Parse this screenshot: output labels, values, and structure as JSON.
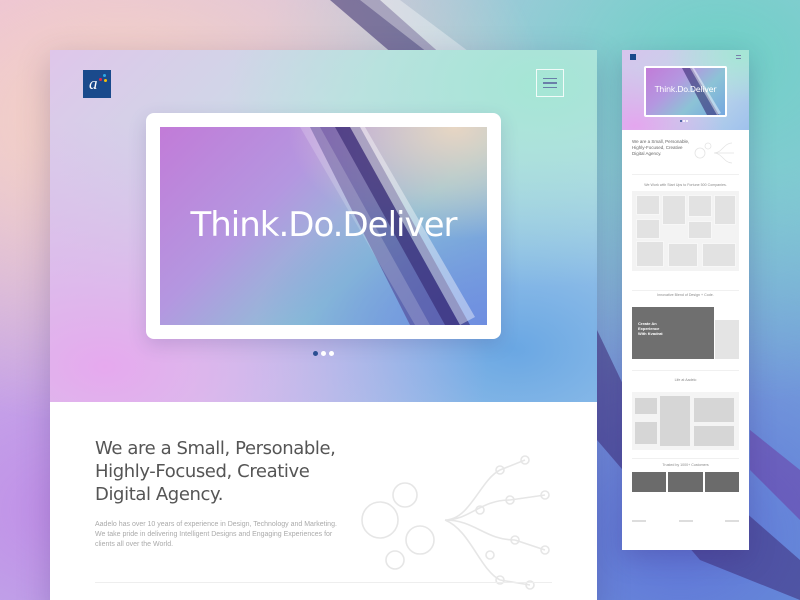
{
  "brand": {
    "logo_letter": "a",
    "logo_color": "#1a4a8c",
    "dot_colors": [
      "#e3254b",
      "#2fa9e6",
      "#f3c10b"
    ]
  },
  "hero": {
    "headline": "Think.Do.Deliver",
    "carousel": {
      "total": 3,
      "active": 1
    }
  },
  "intro": {
    "heading": "We are a Small, Personable, Highly-Focused, Creative Digital Agency.",
    "body": "Aadelo has over 10 years of experience in Design, Technology and Marketing. We take pride in delivering Intelligent Designs and Engaging Experiences for clients all over the World."
  },
  "mobile": {
    "headline": "Think.Do.Deliver",
    "intro": "We are a Small, Personable, Highly-Focused, Creative Digital Agency.",
    "sections": {
      "clients": "We Work with Start Ups to Fortune 500 Companies.",
      "design": "Innovative Blend of Design + Code.",
      "design_card": "Create An Experience With Kvadrat",
      "life": "Life at Aadelo",
      "customers": "Trusted by 1000+ Customers"
    }
  },
  "icons": {
    "menu": "hamburger-icon",
    "illustration": "network-tree-icon"
  }
}
